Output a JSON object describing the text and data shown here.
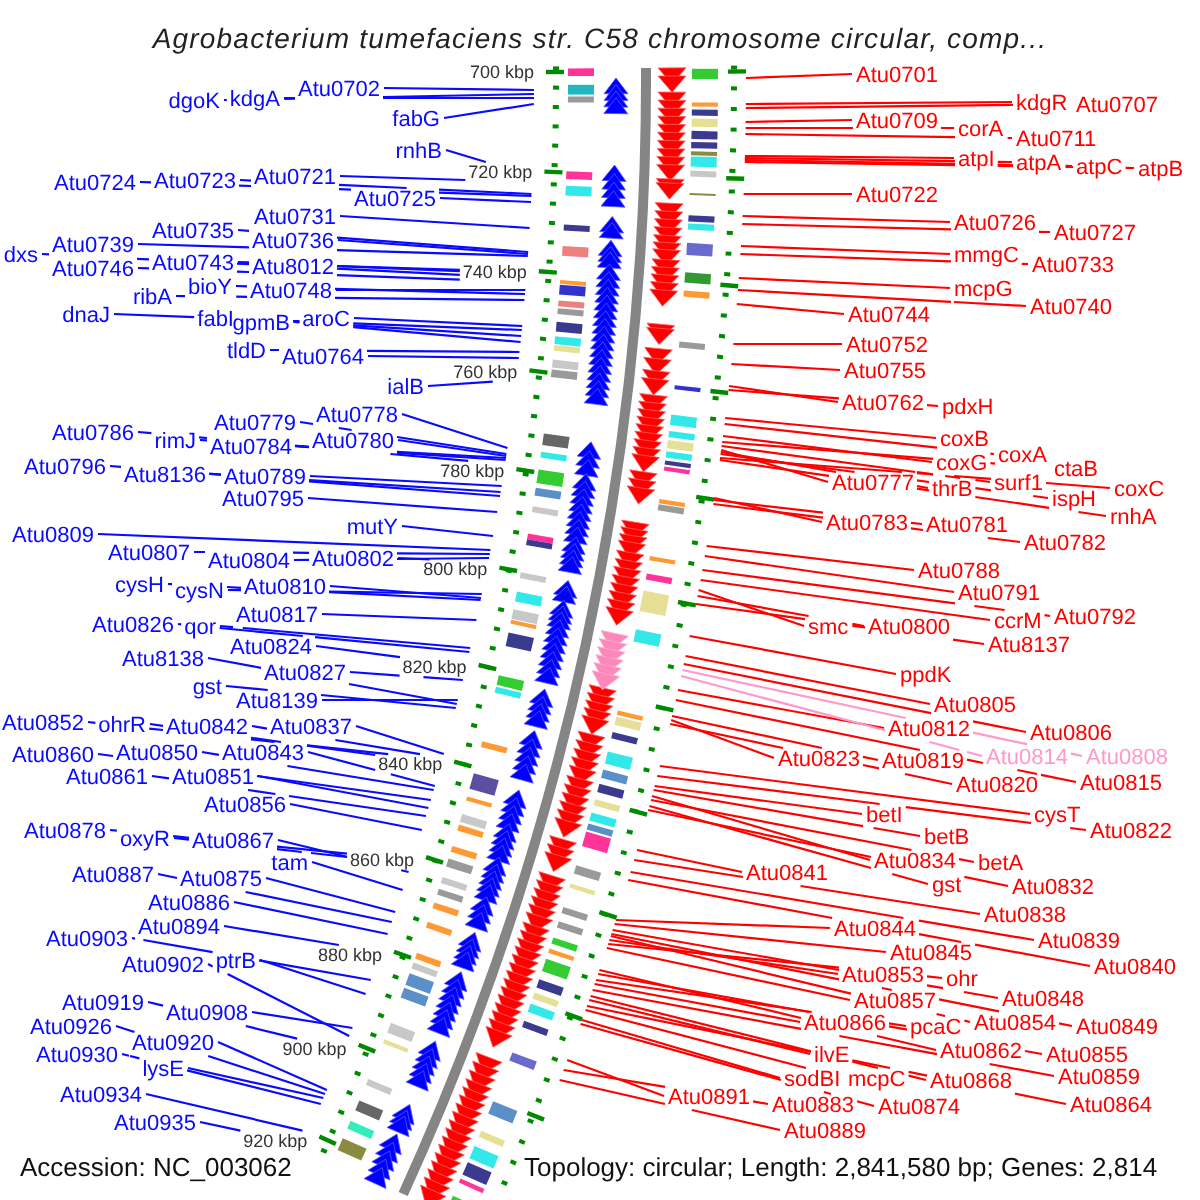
{
  "title": "Agrobacterium tumefaciens str. C58 chromosome circular, comp...",
  "scale_labels": [
    "700 kbp",
    "720 kbp",
    "740 kbp",
    "760 kbp",
    "780 kbp",
    "800 kbp",
    "820 kbp",
    "840 kbp",
    "860 kbp",
    "880 kbp",
    "900 kbp",
    "920 kbp"
  ],
  "left_gene_labels": [
    "dgoK",
    "kdgA",
    "Atu0702",
    "fabG",
    "rnhB",
    "Atu0724",
    "Atu0723",
    "Atu0721",
    "Atu0725",
    "Atu0731",
    "Atu0739",
    "Atu0735",
    "Atu0736",
    "dxs",
    "Atu0746",
    "Atu0743",
    "Atu8012",
    "ribA",
    "bioY",
    "Atu0748",
    "dnaJ",
    "fabI",
    "gpmB",
    "aroC",
    "tldD",
    "Atu0764",
    "ialB",
    "Atu0779",
    "Atu0778",
    "Atu0786",
    "rimJ",
    "Atu0784",
    "Atu0780",
    "Atu0796",
    "Atu8136",
    "Atu0789",
    "Atu0795",
    "Atu0809",
    "mutY",
    "Atu0807",
    "Atu0804",
    "Atu0802",
    "cysH",
    "cysN",
    "Atu0810",
    "Atu0826",
    "qor",
    "Atu0817",
    "Atu0824",
    "Atu8138",
    "Atu0827",
    "gst",
    "Atu8139",
    "Atu0852",
    "ohrR",
    "Atu0842",
    "Atu0837",
    "Atu0860",
    "Atu0850",
    "Atu0843",
    "Atu0861",
    "Atu0851",
    "Atu0856",
    "Atu0878",
    "oxyR",
    "Atu0867",
    "tam",
    "Atu0887",
    "Atu0875",
    "Atu0886",
    "Atu0903",
    "Atu0894",
    "Atu0902",
    "ptrB",
    "Atu0919",
    "Atu0926",
    "Atu0908",
    "Atu0930",
    "Atu0920",
    "lysE",
    "Atu0934",
    "Atu0935"
  ],
  "right_gene_labels": [
    {
      "text": "Atu0701",
      "color": "#ff0000"
    },
    {
      "text": "kdgR",
      "color": "#ff0000"
    },
    {
      "text": "Atu0707",
      "color": "#ff0000"
    },
    {
      "text": "Atu0709",
      "color": "#ff0000"
    },
    {
      "text": "corA",
      "color": "#ff0000"
    },
    {
      "text": "Atu0711",
      "color": "#ff0000"
    },
    {
      "text": "atpI",
      "color": "#ff0000"
    },
    {
      "text": "atpA",
      "color": "#ff0000"
    },
    {
      "text": "atpC",
      "color": "#ff0000"
    },
    {
      "text": "atpB",
      "color": "#ff0000"
    },
    {
      "text": "Atu0722",
      "color": "#ff0000"
    },
    {
      "text": "Atu0726",
      "color": "#ff0000"
    },
    {
      "text": "Atu0727",
      "color": "#ff0000"
    },
    {
      "text": "mmgC",
      "color": "#ff0000"
    },
    {
      "text": "Atu0733",
      "color": "#ff0000"
    },
    {
      "text": "mcpG",
      "color": "#ff0000"
    },
    {
      "text": "Atu0744",
      "color": "#ff0000"
    },
    {
      "text": "Atu0740",
      "color": "#ff0000"
    },
    {
      "text": "Atu0752",
      "color": "#ff0000"
    },
    {
      "text": "Atu0755",
      "color": "#ff0000"
    },
    {
      "text": "Atu0762",
      "color": "#ff0000"
    },
    {
      "text": "pdxH",
      "color": "#ff0000"
    },
    {
      "text": "coxB",
      "color": "#ff0000"
    },
    {
      "text": "coxG",
      "color": "#ff0000"
    },
    {
      "text": "coxA",
      "color": "#ff0000"
    },
    {
      "text": "ctaB",
      "color": "#ff0000"
    },
    {
      "text": "Atu0777",
      "color": "#ff0000"
    },
    {
      "text": "thrB",
      "color": "#ff0000"
    },
    {
      "text": "surf1",
      "color": "#ff0000"
    },
    {
      "text": "ispH",
      "color": "#ff0000"
    },
    {
      "text": "coxC",
      "color": "#ff0000"
    },
    {
      "text": "Atu0783",
      "color": "#ff0000"
    },
    {
      "text": "Atu0781",
      "color": "#ff0000"
    },
    {
      "text": "rnhA",
      "color": "#ff0000"
    },
    {
      "text": "Atu0782",
      "color": "#ff0000"
    },
    {
      "text": "Atu0788",
      "color": "#ff0000"
    },
    {
      "text": "Atu0791",
      "color": "#ff0000"
    },
    {
      "text": "smc",
      "color": "#ff0000"
    },
    {
      "text": "Atu0800",
      "color": "#ff0000"
    },
    {
      "text": "ccrM",
      "color": "#ff0000"
    },
    {
      "text": "Atu0792",
      "color": "#ff0000"
    },
    {
      "text": "Atu8137",
      "color": "#ff0000"
    },
    {
      "text": "ppdK",
      "color": "#ff0000"
    },
    {
      "text": "Atu0805",
      "color": "#ff0000"
    },
    {
      "text": "Atu0812",
      "color": "#ff0000"
    },
    {
      "text": "Atu0806",
      "color": "#ff0000"
    },
    {
      "text": "Atu0823",
      "color": "#ff0000"
    },
    {
      "text": "Atu0819",
      "color": "#ff0000"
    },
    {
      "text": "Atu0814",
      "color": "#ff99cc"
    },
    {
      "text": "Atu0808",
      "color": "#ff99cc"
    },
    {
      "text": "Atu0820",
      "color": "#ff0000"
    },
    {
      "text": "Atu0815",
      "color": "#ff0000"
    },
    {
      "text": "betI",
      "color": "#ff0000"
    },
    {
      "text": "cysT",
      "color": "#ff0000"
    },
    {
      "text": "betB",
      "color": "#ff0000"
    },
    {
      "text": "Atu0822",
      "color": "#ff0000"
    },
    {
      "text": "Atu0841",
      "color": "#ff0000"
    },
    {
      "text": "Atu0834",
      "color": "#ff0000"
    },
    {
      "text": "betA",
      "color": "#ff0000"
    },
    {
      "text": "gst",
      "color": "#ff0000"
    },
    {
      "text": "Atu0832",
      "color": "#ff0000"
    },
    {
      "text": "Atu0838",
      "color": "#ff0000"
    },
    {
      "text": "Atu0844",
      "color": "#ff0000"
    },
    {
      "text": "Atu0839",
      "color": "#ff0000"
    },
    {
      "text": "Atu0845",
      "color": "#ff0000"
    },
    {
      "text": "Atu0853",
      "color": "#ff0000"
    },
    {
      "text": "ohr",
      "color": "#ff0000"
    },
    {
      "text": "Atu0840",
      "color": "#ff0000"
    },
    {
      "text": "Atu0857",
      "color": "#ff0000"
    },
    {
      "text": "Atu0848",
      "color": "#ff0000"
    },
    {
      "text": "Atu0866",
      "color": "#ff0000"
    },
    {
      "text": "pcaC",
      "color": "#ff0000"
    },
    {
      "text": "Atu0854",
      "color": "#ff0000"
    },
    {
      "text": "Atu0849",
      "color": "#ff0000"
    },
    {
      "text": "ilvE",
      "color": "#ff0000"
    },
    {
      "text": "Atu0862",
      "color": "#ff0000"
    },
    {
      "text": "Atu0855",
      "color": "#ff0000"
    },
    {
      "text": "sodBI",
      "color": "#ff0000"
    },
    {
      "text": "mcpC",
      "color": "#ff0000"
    },
    {
      "text": "Atu0868",
      "color": "#ff0000"
    },
    {
      "text": "Atu0859",
      "color": "#ff0000"
    },
    {
      "text": "Atu0891",
      "color": "#ff0000"
    },
    {
      "text": "Atu0883",
      "color": "#ff0000"
    },
    {
      "text": "Atu0874",
      "color": "#ff0000"
    },
    {
      "text": "Atu0864",
      "color": "#ff0000"
    },
    {
      "text": "Atu0889",
      "color": "#ff0000"
    }
  ],
  "footer": {
    "accession": "Accession: NC_003062",
    "summary": "Topology: circular; Length: 2,841,580 bp; Genes: 2,814"
  }
}
